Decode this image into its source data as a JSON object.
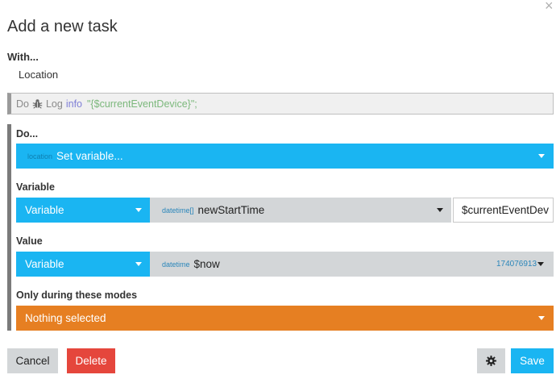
{
  "dialog": {
    "title": "Add a new task",
    "with_label": "With...",
    "with_value": "Location"
  },
  "code_preview": {
    "do": "Do",
    "log": "Log",
    "level": "info",
    "message": "\"{$currentEventDevice}\";"
  },
  "do_section": {
    "label": "Do...",
    "scope_tag": "location",
    "action": "Set variable..."
  },
  "variable_section": {
    "label": "Variable",
    "type": "Variable",
    "var_type_tag": "datetime[]",
    "var_name": "newStartTime",
    "index_value": "$currentEventDev"
  },
  "value_section": {
    "label": "Value",
    "type": "Variable",
    "val_type_tag": "datetime",
    "val_name": "$now",
    "val_number": "174076913"
  },
  "modes_section": {
    "label": "Only during these modes",
    "selected": "Nothing selected"
  },
  "buttons": {
    "cancel": "Cancel",
    "delete": "Delete",
    "save": "Save"
  },
  "colors": {
    "primary_blue": "#1ab5f2",
    "danger_red": "#e5463c",
    "orange": "#e67f22",
    "neutral_grey": "#d3d6d8"
  },
  "icons": {
    "close": "close-icon",
    "bug": "bug-icon",
    "gear": "gear-icon",
    "dropdown": "caret-down-icon"
  }
}
